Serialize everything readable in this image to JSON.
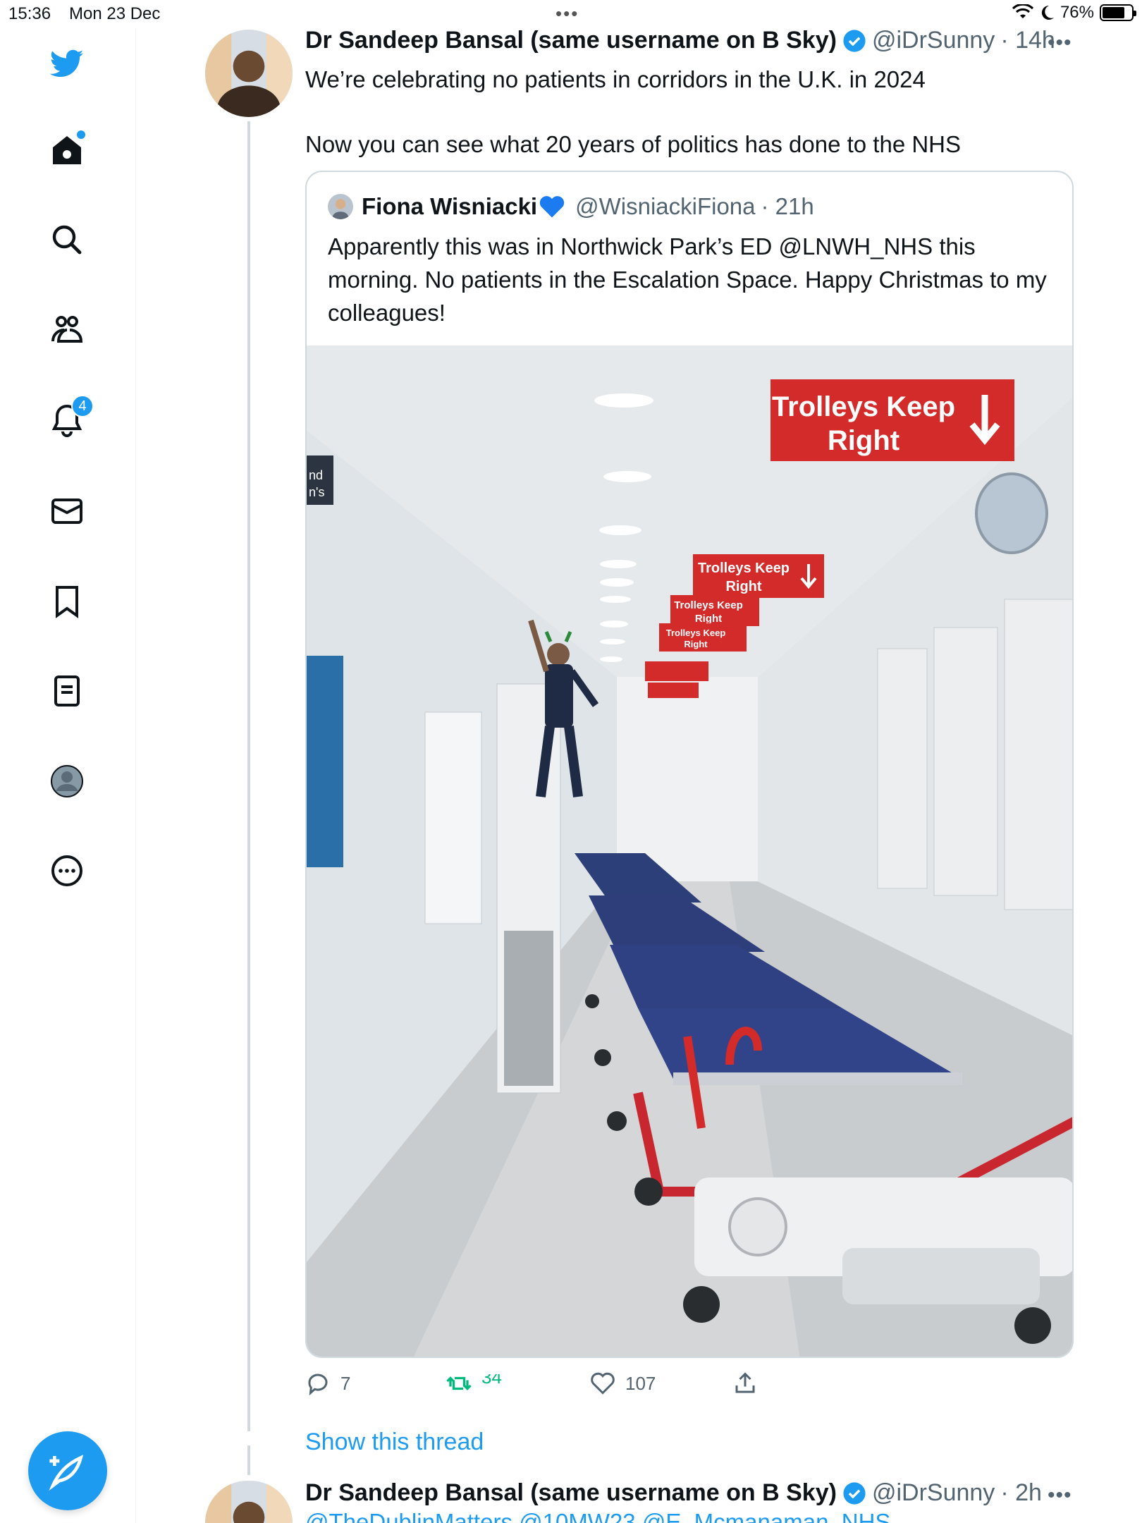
{
  "status_bar": {
    "time": "15:36",
    "date": "Mon 23 Dec",
    "dots": "•••",
    "battery": "76%"
  },
  "sidebar": {
    "items": [
      {
        "icon": "twitter-bird-icon",
        "label": "Twitter"
      },
      {
        "icon": "home-icon",
        "label": "Home"
      },
      {
        "icon": "search-icon",
        "label": "Explore"
      },
      {
        "icon": "communities-icon",
        "label": "Communities"
      },
      {
        "icon": "notifications-icon",
        "label": "Notifications",
        "badge": "4"
      },
      {
        "icon": "messages-icon",
        "label": "Messages"
      },
      {
        "icon": "bookmark-icon",
        "label": "Bookmarks"
      },
      {
        "icon": "lists-icon",
        "label": "Lists"
      },
      {
        "icon": "profile-icon",
        "label": "Profile"
      },
      {
        "icon": "more-icon",
        "label": "More"
      }
    ],
    "compose_icon": "compose-feather-icon",
    "accent": "#1d9bf0"
  },
  "tweet": {
    "name": "Dr Sandeep Bansal (same username on B Sky)",
    "handle": "@iDrSunny",
    "time": "· 14h",
    "more": "•••",
    "text_lines": [
      "We’re celebrating no patients in corridors in the U.K. in 2024",
      "Now you can see what 20 years of politics has done to the NHS"
    ],
    "quote": {
      "name": "Fiona Wisniacki",
      "handle": "@WisniackiFiona",
      "time": "· 21h",
      "text": "Apparently this was in Northwick Park’s ED @LNWH_NHS this morning. No patients in the Escalation Space. Happy Christmas to my colleagues!",
      "photo": {
        "signs": [
          "Trolleys Keep",
          "Right"
        ],
        "partial_sign": [
          "nd",
          "n's"
        ]
      }
    },
    "actions": {
      "replies": "7",
      "retweets": "34",
      "likes": "107"
    },
    "show_thread": "Show this thread"
  },
  "tweet2": {
    "name": "Dr Sandeep Bansal (same username on B Sky)",
    "handle": "@iDrSunny",
    "time": "· 2h",
    "more": "•••",
    "partial_text": "@TheDublinMatters @10MW23 @E_Mcmanaman_NHS"
  }
}
